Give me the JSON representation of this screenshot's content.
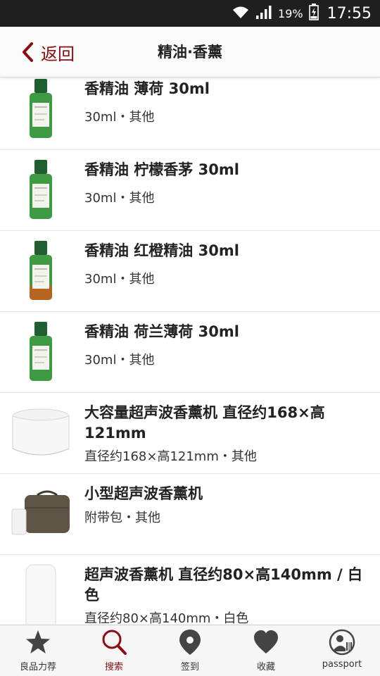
{
  "status_bar": {
    "battery": "19%",
    "time": "17:55"
  },
  "header": {
    "back_label": "返回",
    "title": "精油·香薰"
  },
  "products": [
    {
      "name": "香精油 薄荷 30ml",
      "detail": "30ml・其他",
      "thumb_icon": "green-oil-bottle-icon"
    },
    {
      "name": "香精油 柠檬香茅 30ml",
      "detail": "30ml・其他",
      "thumb_icon": "green-oil-bottle-icon"
    },
    {
      "name": "香精油 红橙精油 30ml",
      "detail": "30ml・其他",
      "thumb_icon": "orange-oil-bottle-icon"
    },
    {
      "name": "香精油 荷兰薄荷 30ml",
      "detail": "30ml・其他",
      "thumb_icon": "green-oil-bottle-icon"
    },
    {
      "name": "大容量超声波香薰机 直径约168×高121mm",
      "detail": "直径约168×高121mm・其他",
      "thumb_icon": "large-diffuser-icon"
    },
    {
      "name": "小型超声波香薰机",
      "detail": "附带包・其他",
      "thumb_icon": "small-diffuser-bag-icon"
    },
    {
      "name": "超声波香薰机 直径约80×高140mm / 白色",
      "detail": "直径约80×高140mm・白色",
      "thumb_icon": "tall-diffuser-icon"
    }
  ],
  "tabs": [
    {
      "label": "良品力荐",
      "icon": "star-icon",
      "active": false
    },
    {
      "label": "搜索",
      "icon": "search-icon",
      "active": true
    },
    {
      "label": "签到",
      "icon": "location-pin-icon",
      "active": false
    },
    {
      "label": "收藏",
      "icon": "heart-icon",
      "active": false
    },
    {
      "label": "passport",
      "icon": "passport-icon",
      "active": false
    }
  ],
  "colors": {
    "accent": "#8b0d13",
    "statusbar": "#1f1f1f",
    "tab_icon": "#444444"
  }
}
